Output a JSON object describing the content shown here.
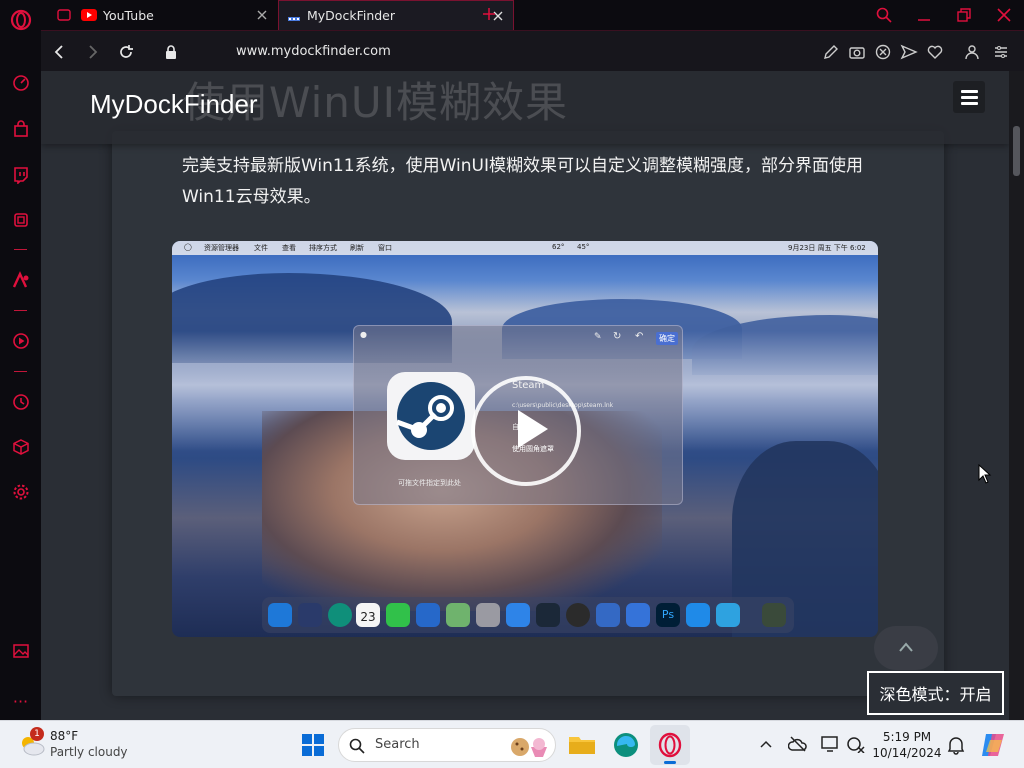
{
  "tabs": [
    {
      "label": "YouTube",
      "active": false
    },
    {
      "label": "MyDockFinder",
      "active": true
    }
  ],
  "address": {
    "url": "www.mydockfinder.com"
  },
  "page": {
    "ghost_title": "使用WinUI模糊效果",
    "brand": "MyDockFinder",
    "description": "完美支持最新版Win11系统，使用WinUI模糊效果可以自定义调整模糊强度，部分界面使用Win11云母效果。"
  },
  "screenshot": {
    "menu_items": [
      "资源管理器",
      "文件",
      "查看",
      "排序方式",
      "刷新",
      "窗口"
    ],
    "menu_right": [
      "62°",
      "45°",
      "9月23日 周五 下午 6:02"
    ],
    "dialog": {
      "title": "Steam",
      "path": "c:\\users\\public\\desktop\\steam.lnk",
      "option1": "自动变化",
      "option2": "使用圆角遮罩",
      "drag_hint": "可拖文件指定到此处",
      "confirm": "确定"
    },
    "dock_date": "23"
  },
  "darkmode": {
    "label": "深色模式：开启"
  },
  "taskbar": {
    "weather_temp": "88°F",
    "weather_desc": "Partly cloudy",
    "weather_badge": "1",
    "search_placeholder": "Search",
    "time": "5:19 PM",
    "date": "10/14/2024"
  },
  "colors": {
    "accent": "#e0103d",
    "page_bg": "#2a2e35",
    "card_bg": "#2f343b"
  }
}
